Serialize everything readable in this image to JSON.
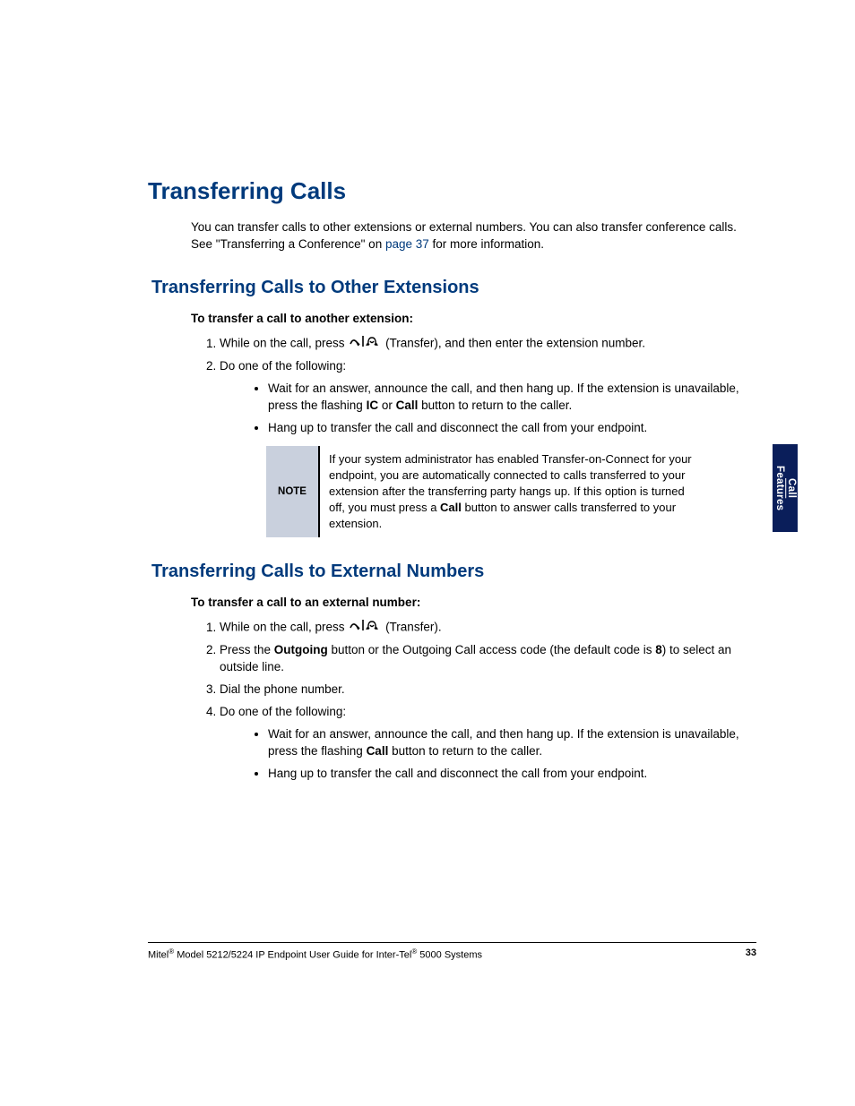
{
  "h1": "Transferring Calls",
  "intro": {
    "t1": "You can transfer calls to other extensions or external numbers. You can also transfer conference calls. See \"Transferring a Conference\" on ",
    "link": "page 37",
    "t2": " for more information."
  },
  "sectionA": {
    "h2": "Transferring Calls to Other Extensions",
    "subhead": "To transfer a call to another extension:",
    "step1": {
      "a": "While on the call, press ",
      "b": " (Transfer), and then enter the extension number."
    },
    "step2": "Do one of the following:",
    "b1": {
      "a": "Wait for an answer, announce the call, and then hang up. If the extension is unavailable, press the flashing ",
      "ic": "IC",
      "or": " or ",
      "call": "Call",
      "b": " button to return to the caller."
    },
    "b2": "Hang up to transfer the call and disconnect the call from your endpoint.",
    "note": {
      "label": "NOTE",
      "a": "If your system administrator has enabled Transfer-on-Connect for your endpoint, you are automatically connected to calls transferred to your extension after the transferring party hangs up. If this option is turned off, you must press a ",
      "call": "Call",
      "b": " button to answer calls transferred to your extension."
    }
  },
  "sectionB": {
    "h2": "Transferring Calls to External Numbers",
    "subhead": "To transfer a call to an external number:",
    "step1": {
      "a": "While on the call, press ",
      "b": " (Transfer)."
    },
    "step2": {
      "a": "Press the ",
      "out": "Outgoing",
      "b": " button or the Outgoing Call access code (the default code is ",
      "eight": "8",
      "c": ") to select an outside line."
    },
    "step3": "Dial the phone number.",
    "step4": "Do one of the following:",
    "b1": {
      "a": "Wait for an answer, announce the call, and then hang up. If the extension is unavailable, press the flashing ",
      "call": "Call",
      "b": " button to return to the caller."
    },
    "b2": "Hang up to transfer the call and disconnect the call from your endpoint."
  },
  "tab": {
    "l1": "Call",
    "l2": "Features"
  },
  "footer": {
    "left_a": "Mitel",
    "left_b": " Model 5212/5224 IP Endpoint User Guide for Inter-Tel",
    "left_c": " 5000 Systems",
    "page": "33"
  }
}
